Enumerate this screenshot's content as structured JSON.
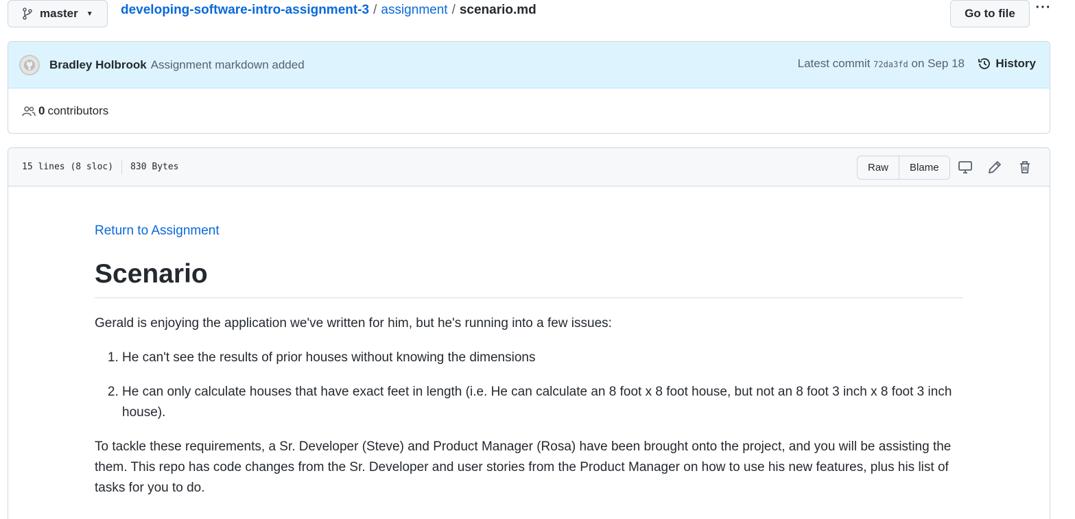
{
  "branch": {
    "name": "master",
    "icon": "git-branch-icon"
  },
  "breadcrumb": {
    "repo": "developing-software-intro-assignment-3",
    "sep1": "/",
    "dir": "assignment",
    "sep2": "/",
    "file": "scenario.md"
  },
  "toolbar": {
    "goto_file_label": "Go to file",
    "more_label": "···"
  },
  "commit": {
    "author": "Bradley Holbrook",
    "message": "Assignment markdown added",
    "latest_prefix": "Latest commit",
    "sha": "72da3fd",
    "date": "on Sep 18",
    "history_label": "History"
  },
  "contributors": {
    "count": "0",
    "label": "contributors"
  },
  "file_info": {
    "lines": "15 lines (8 sloc)",
    "size": "830 Bytes",
    "raw_label": "Raw",
    "blame_label": "Blame"
  },
  "content": {
    "return_link": "Return to Assignment",
    "heading": "Scenario",
    "intro": "Gerald is enjoying the application we've written for him, but he's running into a few issues:",
    "issues": [
      "He can't see the results of prior houses without knowing the dimensions",
      "He can only calculate houses that have exact feet in length (i.e. He can calculate an 8 foot x 8 foot house, but not an 8 foot 3 inch x 8 foot 3 inch house)."
    ],
    "paragraph": "To tackle these requirements, a Sr. Developer (Steve) and Product Manager (Rosa) have been brought onto the project, and you will be assisting the them. This repo has code changes from the Sr. Developer and user stories from the Product Manager on how to use his new features, plus his list of tasks for you to do."
  },
  "colors": {
    "link": "#0969da",
    "commit_bg": "#ddf4ff",
    "header_bg": "#f6f8fa",
    "border": "#d0d7de"
  }
}
